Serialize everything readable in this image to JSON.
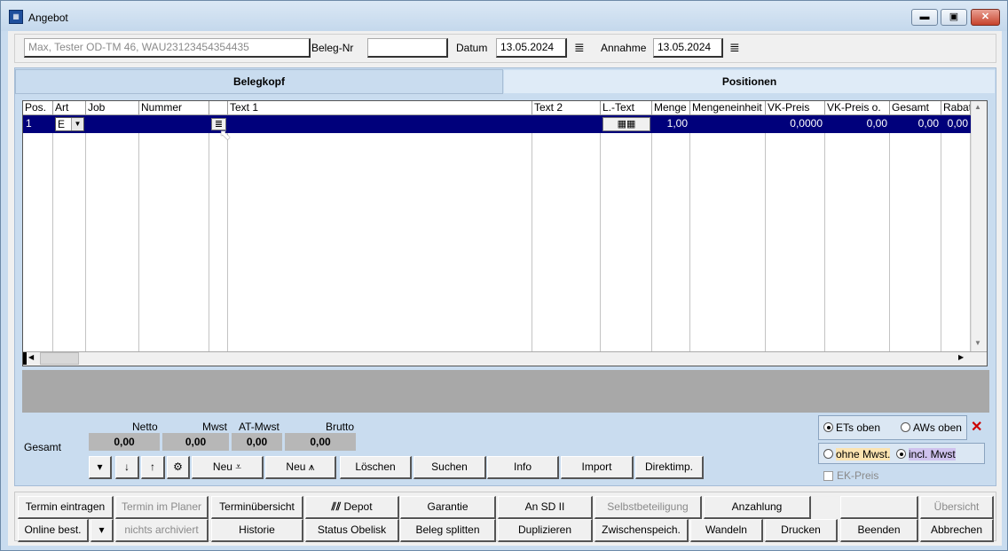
{
  "window": {
    "title": "Angebot"
  },
  "header": {
    "customer": "Max, Tester OD-TM 46, WAU23123454354435",
    "beleg_nr_label": "Beleg-Nr",
    "beleg_nr_value": "",
    "datum_label": "Datum",
    "datum_value": "13.05.2024",
    "annahme_label": "Annahme",
    "annahme_value": "13.05.2024"
  },
  "tabs": {
    "belegkopf": "Belegkopf",
    "positionen": "Positionen"
  },
  "grid": {
    "columns": [
      "Pos.",
      "Art",
      "Job",
      "Nummer",
      "",
      "Text 1",
      "Text 2",
      "L.-Text",
      "Menge",
      "Mengeneinheit",
      "VK-Preis",
      "VK-Preis o.",
      "Gesamt",
      "Rabatt"
    ],
    "row": {
      "pos": "1",
      "art": "E",
      "menge": "1,00",
      "vk_preis": "0,0000",
      "vk_preis_o": "0,00",
      "gesamt": "0,00",
      "rabatt": "0,00"
    }
  },
  "totals": {
    "label": "Gesamt",
    "netto_label": "Netto",
    "mwst_label": "Mwst",
    "at_mwst_label": "AT-Mwst",
    "brutto_label": "Brutto",
    "netto": "0,00",
    "mwst": "0,00",
    "at_mwst": "0,00",
    "brutto": "0,00"
  },
  "position_buttons": {
    "neu1": "Neu",
    "neu2": "Neu",
    "loeschen": "Löschen",
    "suchen": "Suchen",
    "info": "Info",
    "import": "Import",
    "direktimp": "Direktimp."
  },
  "options": {
    "ets_oben": "ETs oben",
    "aws_oben": "AWs oben",
    "ohne_mwst": "ohne Mwst.",
    "incl_mwst": "incl. Mwst",
    "ek_preis": "EK-Preis"
  },
  "bottom_buttons": {
    "row1": [
      "Termin eintragen",
      "Termin im Planer",
      "Terminübersicht",
      "Depot",
      "Garantie",
      "An SD II",
      "Selbstbeteiligung",
      "Anzahlung",
      "",
      "Übersicht"
    ],
    "row2": [
      "Online best.",
      "nichts archiviert",
      "Historie",
      "Status Obelisk",
      "Beleg splitten",
      "Duplizieren",
      "Zwischenspeich.",
      "Wandeln",
      "Drucken",
      "Beenden",
      "Abbrechen"
    ]
  }
}
